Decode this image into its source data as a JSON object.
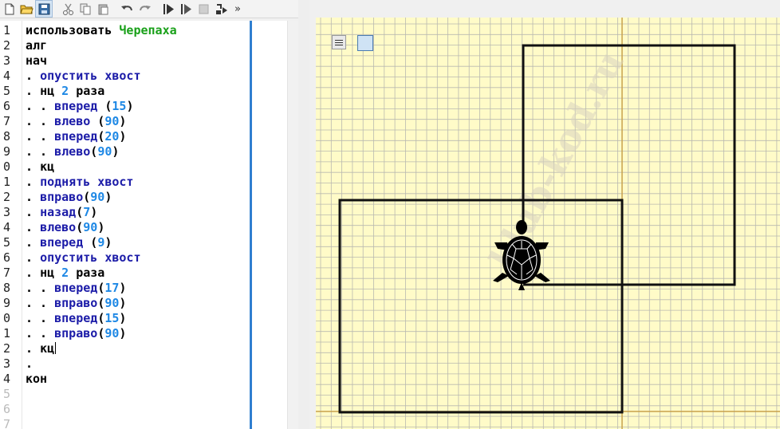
{
  "toolbar": {
    "buttons": [
      "new-file-icon",
      "open-folder-icon",
      "save-icon",
      "cut-icon",
      "copy-icon",
      "paste-icon",
      "undo-icon",
      "redo-icon",
      "run-icon",
      "step-run-icon",
      "stop-icon",
      "step-into-icon"
    ],
    "overflow_label": "»"
  },
  "editor": {
    "line_numbers": [
      "1",
      "2",
      "3",
      "4",
      "5",
      "6",
      "7",
      "8",
      "9",
      "0",
      "1",
      "2",
      "3",
      "4",
      "5",
      "6",
      "7",
      "8",
      "9",
      "0",
      "1",
      "2",
      "3",
      "4",
      "5",
      "6",
      "7"
    ],
    "lines": [
      {
        "dots": "",
        "a": "использовать ",
        "b": "Черепаха"
      },
      {
        "dots": "",
        "a": "алг"
      },
      {
        "dots": "",
        "a": "нач"
      },
      {
        "dots": ". ",
        "cmd": "опустить хвост"
      },
      {
        "dots": ". ",
        "a": "нц ",
        "n": "2",
        "c": " раза"
      },
      {
        "dots": ". . ",
        "cmd": "вперед",
        "p": " (",
        "n": "15",
        "q": ")"
      },
      {
        "dots": ". . ",
        "cmd": "влево",
        "p": " (",
        "n": "90",
        "q": ")"
      },
      {
        "dots": ". . ",
        "cmd": "вперед",
        "p": "(",
        "n": "20",
        "q": ")"
      },
      {
        "dots": ". . ",
        "cmd": "влево",
        "p": "(",
        "n": "90",
        "q": ")"
      },
      {
        "dots": ". ",
        "a": "кц"
      },
      {
        "dots": ". ",
        "cmd": "поднять хвост"
      },
      {
        "dots": ". ",
        "cmd": "вправо",
        "p": "(",
        "n": "90",
        "q": ")"
      },
      {
        "dots": ". ",
        "cmd": "назад",
        "p": "(",
        "n": "7",
        "q": ")"
      },
      {
        "dots": ". ",
        "cmd": "влево",
        "p": "(",
        "n": "90",
        "q": ")"
      },
      {
        "dots": ". ",
        "cmd": "вперед",
        "p": " (",
        "n": "9",
        "q": ")"
      },
      {
        "dots": ". ",
        "cmd": "опустить хвост"
      },
      {
        "dots": ". ",
        "a": "нц ",
        "n": "2",
        "c": " раза"
      },
      {
        "dots": ". . ",
        "cmd": "вперед",
        "p": "(",
        "n": "17",
        "q": ")"
      },
      {
        "dots": ". . ",
        "cmd": "вправо",
        "p": "(",
        "n": "90",
        "q": ")"
      },
      {
        "dots": ". . ",
        "cmd": "вперед",
        "p": "(",
        "n": "15",
        "q": ")"
      },
      {
        "dots": ". . ",
        "cmd": "вправо",
        "p": "(",
        "n": "90",
        "q": ")"
      },
      {
        "dots": ". ",
        "a": "кц",
        "cursor": true
      },
      {
        "dots": "."
      },
      {
        "dots": "",
        "a": "кон"
      }
    ]
  },
  "canvas": {
    "background": "#fffbc8",
    "grid_color": "#b9b9b0",
    "axis_color": "#c8a24a",
    "watermark": "klub-kod.ru",
    "turtle_icon": "turtle-icon",
    "line_color": "#111111"
  }
}
